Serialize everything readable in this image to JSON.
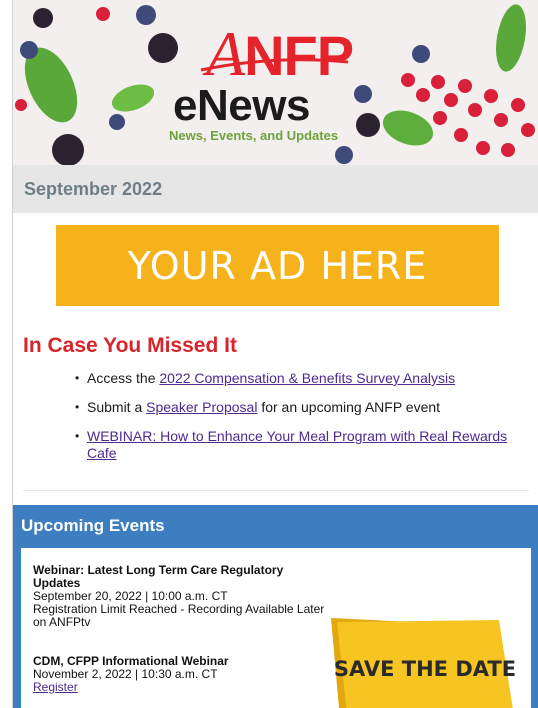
{
  "header": {
    "brand": "ANFP",
    "brand_first": "A",
    "brand_rest": "NFP",
    "product": "eNews",
    "tagline": "News, Events, and Updates"
  },
  "issue": {
    "date": "September 2022"
  },
  "ad": {
    "label": "YOUR AD HERE"
  },
  "missed": {
    "title": "In Case You Missed It",
    "items": [
      {
        "before": "Access the ",
        "link": "2022 Compensation & Benefits Survey Analysis",
        "after": ""
      },
      {
        "before": "Submit a ",
        "link": "Speaker Proposal",
        "after": " for an upcoming ANFP event"
      },
      {
        "before": "",
        "link": "WEBINAR: How to Enhance Your Meal Program with Real Rewards Cafe",
        "after": ""
      }
    ]
  },
  "events": {
    "title": "Upcoming Events",
    "items": [
      {
        "title": "Webinar: Latest Long Term Care Regulatory Updates",
        "date": "September 20, 2022 | 10:00 a.m. CT",
        "note": "Registration Limit Reached - Recording Available Later on ANFPtv"
      },
      {
        "title": "CDM, CFPP Informational Webinar",
        "date": "November 2, 2022 | 10:30 a.m. CT",
        "link": "Register"
      }
    ],
    "save_the_date": "SAVE THE DATE"
  },
  "colors": {
    "brand_red": "#e5232b",
    "tagline_green": "#6ea23a",
    "date_bar": "#e7e6e6",
    "ad_yellow": "#f6b21a",
    "section_red": "#d6252b",
    "events_blue": "#3d7ec1",
    "link_purple": "#4c2a8f",
    "sign_yellow": "#f7c521"
  }
}
